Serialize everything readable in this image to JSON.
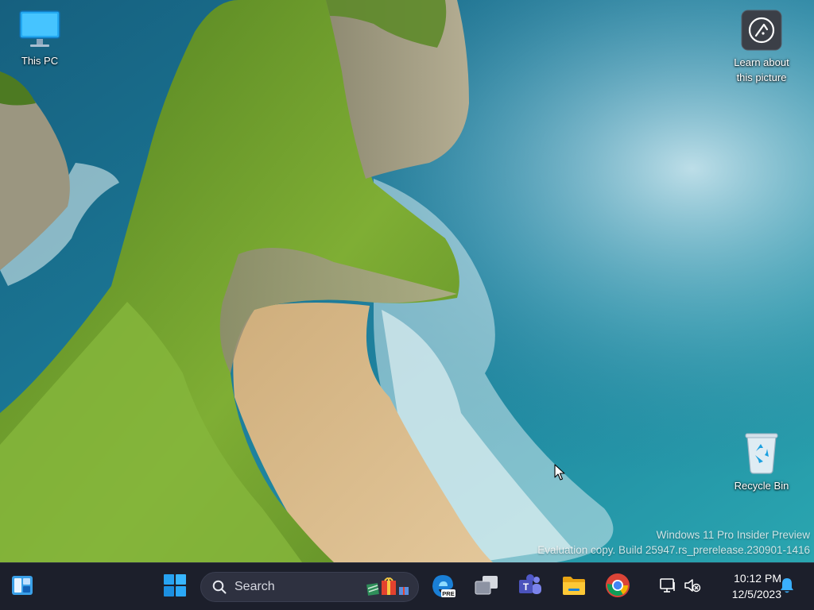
{
  "desktop": {
    "icons": [
      {
        "label": "This PC",
        "icon": "monitor-icon"
      },
      {
        "label": "Learn about this picture",
        "icon": "camera-info-icon"
      },
      {
        "label": "Recycle Bin",
        "icon": "recycle-bin-icon"
      }
    ],
    "watermark": {
      "line1": "Windows 11 Pro Insider Preview",
      "line2": "Evaluation copy. Build 25947.rs_prerelease.230901-1416"
    }
  },
  "taskbar": {
    "search_placeholder": "Search",
    "apps": [
      {
        "name": "Widgets",
        "icon": "widgets-icon"
      },
      {
        "name": "Start",
        "icon": "windows-logo-icon"
      },
      {
        "name": "Microsoft Edge Canary",
        "icon": "edge-pre-icon",
        "badge": "PRE"
      },
      {
        "name": "Task View",
        "icon": "task-view-icon"
      },
      {
        "name": "Microsoft Teams",
        "icon": "teams-icon"
      },
      {
        "name": "File Explorer",
        "icon": "folder-icon"
      },
      {
        "name": "Google Chrome",
        "icon": "chrome-icon"
      }
    ],
    "tray": {
      "network_icon": "network-monitor-icon",
      "volume_icon": "volume-muted-icon",
      "time": "10:12 PM",
      "date": "12/5/2023",
      "notification_icon": "bell-icon"
    }
  },
  "colors": {
    "taskbar_bg": "#1c1f2b",
    "ocean": "#1b6f8f",
    "cliff_green": "#6e9a2e",
    "sand": "#d8b98a",
    "windows_blue": "#0a84ff"
  }
}
